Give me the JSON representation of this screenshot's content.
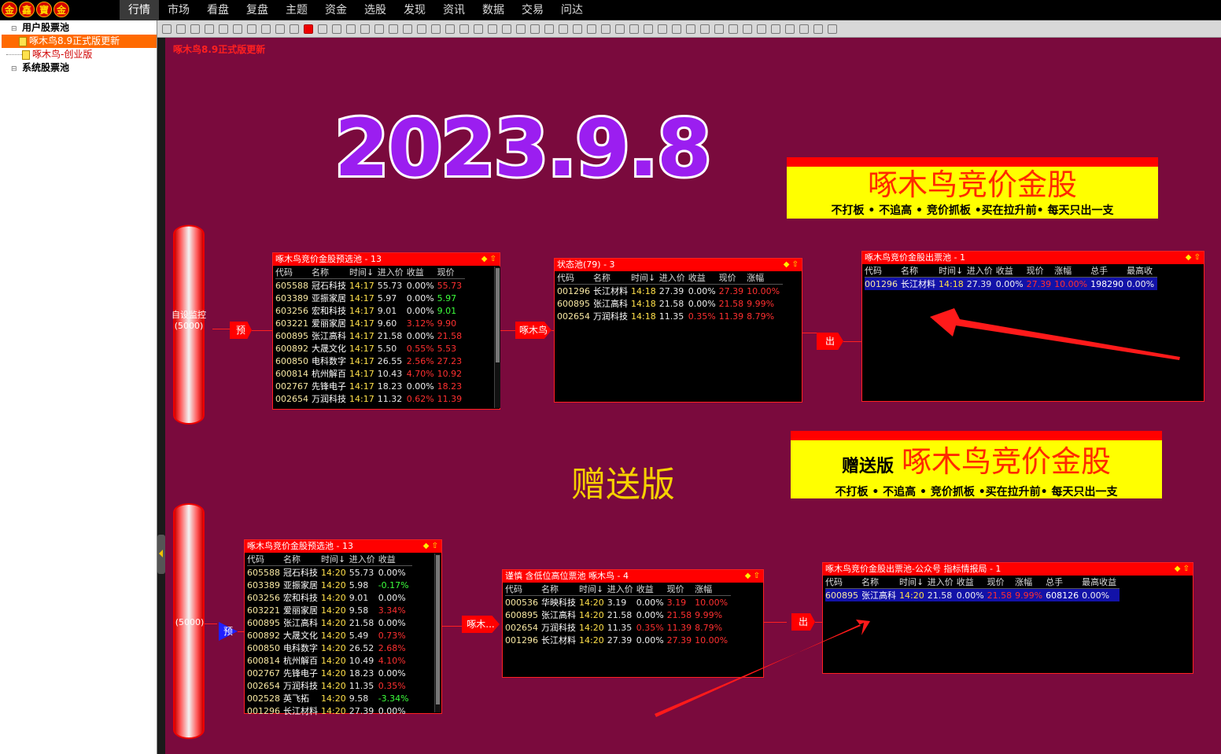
{
  "logo": [
    "金",
    "鑫",
    "寶",
    "金"
  ],
  "menu": [
    "行情",
    "市场",
    "看盘",
    "复盘",
    "主题",
    "资金",
    "选股",
    "发现",
    "资讯",
    "数据",
    "交易",
    "问达"
  ],
  "sidebar": {
    "user_pool": "用户股票池",
    "item1": "啄木鸟8.9正式版更新",
    "item2": "啄木鸟-创业版",
    "system_pool": "系统股票池"
  },
  "canvas": {
    "title": "啄木鸟8.9正式版更新",
    "date": "2023.9.8",
    "gift": "赠送版"
  },
  "banner1": {
    "title": "啄木鸟竞价金股",
    "sub": "不打板 • 不追高 • 竞价抓板 •买在拉升前• 每天只出一支"
  },
  "banner2": {
    "prefix": "赠送版",
    "title": "啄木鸟竞价金股",
    "sub": "不打板 • 不追高 • 竞价抓板 •买在拉升前• 每天只出一支"
  },
  "flow1": {
    "cyl_label": "自设监控\n(5000)",
    "tag_pre": "预",
    "tag_mid": "啄木鸟",
    "tag_out": "出"
  },
  "flow2": {
    "cyl_label": "(5000)",
    "tag_pre": "预",
    "tag_mid": "啄木...",
    "tag_out": "出"
  },
  "colors": {
    "canvas": "#7a0a3d",
    "panel_title": "#ff0000",
    "banner": "#ffff00",
    "date": "#9b1ef0",
    "gift": "#f6d100"
  },
  "panels": {
    "p1": {
      "title": "啄木鸟竞价金股预选池 - 13",
      "headers": [
        "代码",
        "名称",
        "时间↓",
        "进入价",
        "收益",
        "现价"
      ],
      "rows": [
        [
          "605588",
          "冠石科技",
          "14:17",
          "55.73",
          "0.00%",
          "55.73"
        ],
        [
          "603389",
          "亚振家居",
          "14:17",
          "5.97",
          "0.00%",
          "5.97"
        ],
        [
          "603256",
          "宏和科技",
          "14:17",
          "9.01",
          "0.00%",
          "9.01"
        ],
        [
          "603221",
          "爱丽家居",
          "14:17",
          "9.60",
          "3.12%",
          "9.90"
        ],
        [
          "600895",
          "张江高科",
          "14:17",
          "21.58",
          "0.00%",
          "21.58"
        ],
        [
          "600892",
          "大晟文化",
          "14:17",
          "5.50",
          "0.55%",
          "5.53"
        ],
        [
          "600850",
          "电科数字",
          "14:17",
          "26.55",
          "2.56%",
          "27.23"
        ],
        [
          "600814",
          "杭州解百",
          "14:17",
          "10.43",
          "4.70%",
          "10.92"
        ],
        [
          "002767",
          "先锋电子",
          "14:17",
          "18.23",
          "0.00%",
          "18.23"
        ],
        [
          "002654",
          "万润科技",
          "14:17",
          "11.32",
          "0.62%",
          "11.39"
        ]
      ]
    },
    "p2": {
      "title": "状态池(79) - 3",
      "headers": [
        "代码",
        "名称",
        "时间↓",
        "进入价",
        "收益",
        "现价",
        "涨幅"
      ],
      "rows": [
        [
          "001296",
          "长江材料",
          "14:18",
          "27.39",
          "0.00%",
          "27.39",
          "10.00%"
        ],
        [
          "600895",
          "张江高科",
          "14:18",
          "21.58",
          "0.00%",
          "21.58",
          "9.99%"
        ],
        [
          "002654",
          "万润科技",
          "14:18",
          "11.35",
          "0.35%",
          "11.39",
          "8.79%"
        ]
      ]
    },
    "p3": {
      "title": "啄木鸟竞价金股出票池 - 1",
      "headers": [
        "代码",
        "名称",
        "时间↓",
        "进入价",
        "收益",
        "现价",
        "涨幅",
        "总手",
        "最高收"
      ],
      "rows": [
        [
          "001296",
          "长江材料",
          "14:18",
          "27.39",
          "0.00%",
          "27.39",
          "10.00%",
          "198290",
          "0.00%"
        ]
      ]
    },
    "p4": {
      "title": "啄木鸟竞价金股预选池 - 13",
      "headers": [
        "代码",
        "名称",
        "时间↓",
        "进入价",
        "收益"
      ],
      "rows": [
        [
          "605588",
          "冠石科技",
          "14:20",
          "55.73",
          "0.00%"
        ],
        [
          "603389",
          "亚振家居",
          "14:20",
          "5.98",
          "-0.17%"
        ],
        [
          "603256",
          "宏和科技",
          "14:20",
          "9.01",
          "0.00%"
        ],
        [
          "603221",
          "爱丽家居",
          "14:20",
          "9.58",
          "3.34%"
        ],
        [
          "600895",
          "张江高科",
          "14:20",
          "21.58",
          "0.00%"
        ],
        [
          "600892",
          "大晟文化",
          "14:20",
          "5.49",
          "0.73%"
        ],
        [
          "600850",
          "电科数字",
          "14:20",
          "26.52",
          "2.68%"
        ],
        [
          "600814",
          "杭州解百",
          "14:20",
          "10.49",
          "4.10%"
        ],
        [
          "002767",
          "先锋电子",
          "14:20",
          "18.23",
          "0.00%"
        ],
        [
          "002654",
          "万润科技",
          "14:20",
          "11.35",
          "0.35%"
        ],
        [
          "002528",
          "英飞拓",
          "14:20",
          "9.58",
          "-3.34%"
        ],
        [
          "001296",
          "长江材料",
          "14:20",
          "27.39",
          "0.00%"
        ]
      ]
    },
    "p5": {
      "title": "谨慎 含低位高位票池 啄木鸟 - 4",
      "headers": [
        "代码",
        "名称",
        "时间↓",
        "进入价",
        "收益",
        "现价",
        "涨幅"
      ],
      "rows": [
        [
          "000536",
          "华映科技",
          "14:20",
          "3.19",
          "0.00%",
          "3.19",
          "10.00%"
        ],
        [
          "600895",
          "张江高科",
          "14:20",
          "21.58",
          "0.00%",
          "21.58",
          "9.99%"
        ],
        [
          "002654",
          "万润科技",
          "14:20",
          "11.35",
          "0.35%",
          "11.39",
          "8.79%"
        ],
        [
          "001296",
          "长江材料",
          "14:20",
          "27.39",
          "0.00%",
          "27.39",
          "10.00%"
        ]
      ]
    },
    "p6": {
      "title": "啄木鸟竞价金股出票池-公众号 指标情报局 - 1",
      "headers": [
        "代码",
        "名称",
        "时间↓",
        "进入价",
        "收益",
        "现价",
        "涨幅",
        "总手",
        "最高收益"
      ],
      "rows": [
        [
          "600895",
          "张江高科",
          "14:20",
          "21.58",
          "0.00%",
          "21.58",
          "9.99%",
          "608126",
          "0.00%"
        ]
      ]
    }
  }
}
